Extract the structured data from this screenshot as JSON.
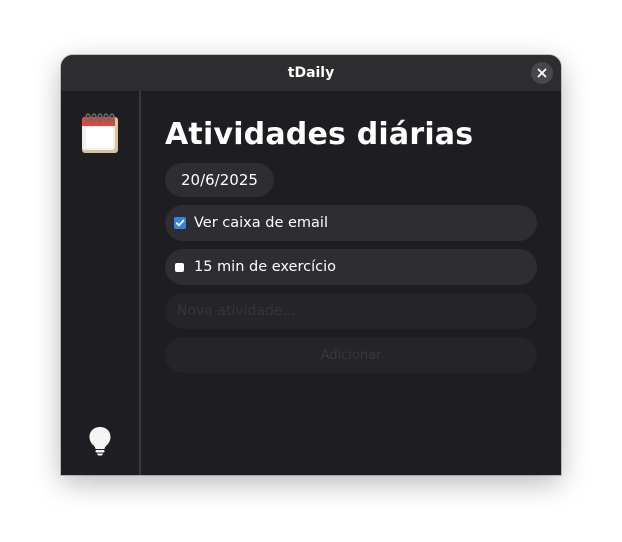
{
  "window": {
    "title": "tDaily"
  },
  "sidebar": {
    "app_icon": "calendar-icon",
    "bottom_icon": "lightbulb-icon"
  },
  "main": {
    "heading": "Atividades diárias",
    "date": "20/6/2025",
    "tasks": [
      {
        "label": "Ver caixa de email",
        "checked": true
      },
      {
        "label": "15 min de exercício",
        "checked": false
      }
    ],
    "new_task_placeholder": "Nova atividade...",
    "add_button_label": "Adicionar"
  },
  "colors": {
    "window_bg": "#1e1e22",
    "titlebar_bg": "#2d2d30",
    "row_bg": "#2e2e32",
    "accent": "#3584e4"
  }
}
